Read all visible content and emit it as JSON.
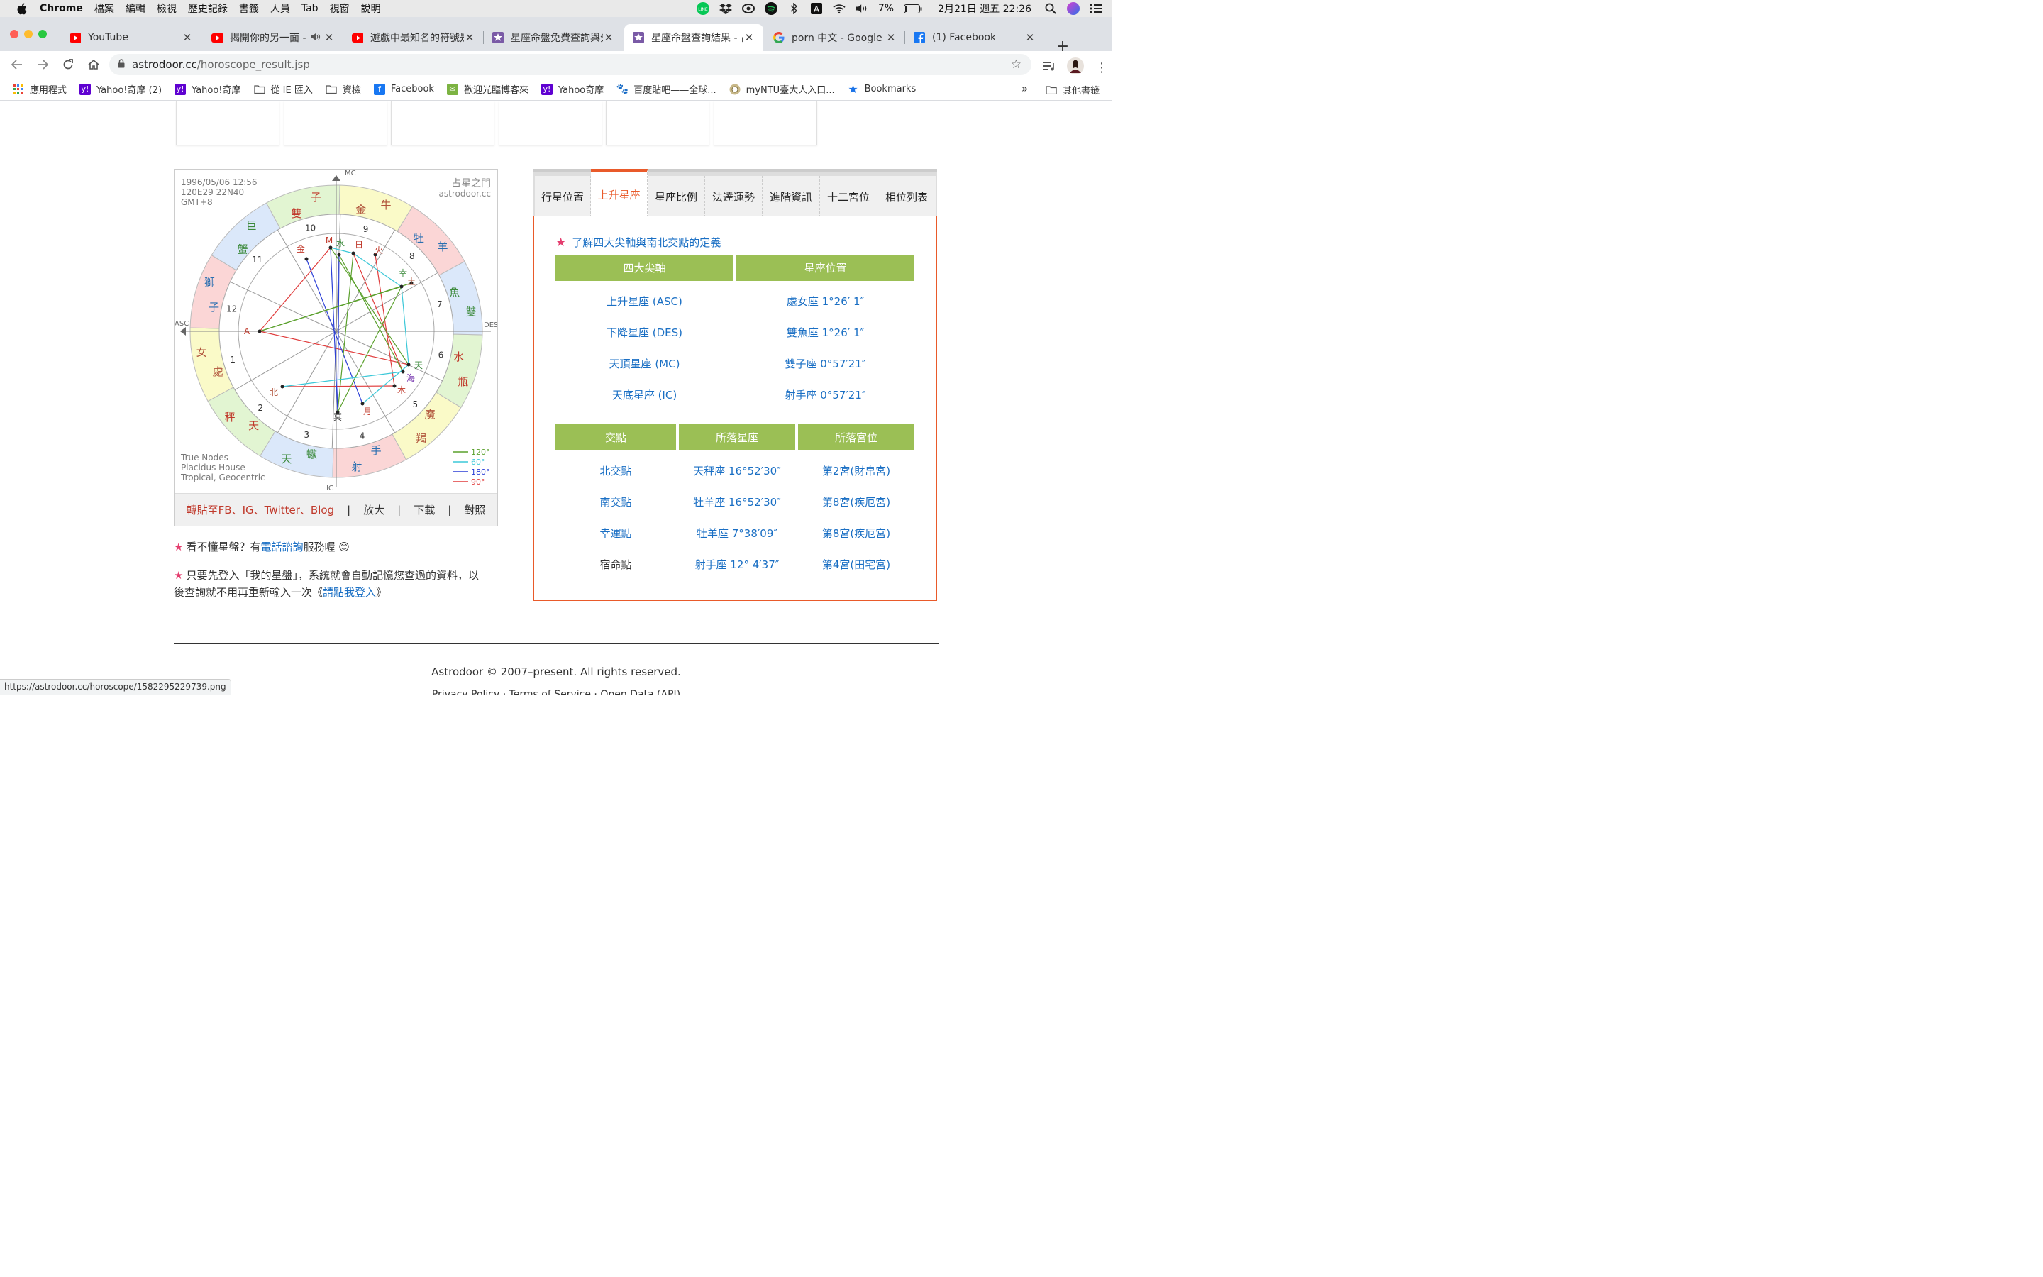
{
  "menubar": {
    "app": "Chrome",
    "items": [
      "檔案",
      "編輯",
      "檢視",
      "歷史記錄",
      "書籤",
      "人員",
      "Tab",
      "視窗",
      "說明"
    ],
    "battery": "7%",
    "datetime": "2月21日 週五  22:26"
  },
  "tabs": [
    {
      "title": "YouTube",
      "icon": "youtube-icon",
      "active": false
    },
    {
      "title": "揭開你的另一面 -",
      "icon": "youtube-icon",
      "active": false,
      "audio": true
    },
    {
      "title": "遊戲中最知名的符號是",
      "icon": "youtube-icon",
      "active": false
    },
    {
      "title": "星座命盤免費查詢與分",
      "icon": "astrodoor-icon",
      "active": false
    },
    {
      "title": "星座命盤查詢結果 - 占",
      "icon": "astrodoor-icon",
      "active": true
    },
    {
      "title": "porn 中文 - Google 搜",
      "icon": "google-icon",
      "active": false
    },
    {
      "title": "(1) Facebook",
      "icon": "facebook-icon",
      "active": false
    }
  ],
  "address": {
    "host": "astrodoor.cc",
    "path": "/horoscope_result.jsp"
  },
  "bookmarks": [
    "應用程式",
    "Yahoo!奇摩 (2)",
    "Yahoo!奇摩",
    "從 IE 匯入",
    "資檢",
    "Facebook",
    "歡迎光臨博客來",
    "Yahoo奇摩",
    "百度貼吧——全球...",
    "myNTU臺大人入口...",
    "Bookmarks"
  ],
  "bookmarks_more": "»",
  "bookmarks_other": "其他書籤",
  "chart": {
    "info": [
      "1996/05/06 12:56",
      "120E29 22N40",
      "GMT+8"
    ],
    "brand": [
      "占星之門",
      "astrodoor.cc"
    ],
    "footer": [
      "True Nodes",
      "Placidus House",
      "Tropical, Geocentric"
    ],
    "legend": [
      {
        "label": "120°",
        "color": "#5aa02c"
      },
      {
        "label": "60°",
        "color": "#3cc8d8"
      },
      {
        "label": "180°",
        "color": "#2b3fd6"
      },
      {
        "label": "90°",
        "color": "#e03c3c"
      }
    ],
    "axes": {
      "mc": "MC",
      "ic": "IC",
      "asc": "ASC",
      "des": "DES"
    },
    "signs": [
      "子",
      "雙",
      "牛",
      "金",
      "羊",
      "牡",
      "魚",
      "雙",
      "瓶",
      "水",
      "羯",
      "魔",
      "手",
      "射",
      "蠍",
      "天",
      "秤",
      "天",
      "女",
      "處",
      "子",
      "獅",
      "蟹",
      "巨"
    ],
    "houses": [
      "1",
      "2",
      "3",
      "4",
      "5",
      "6",
      "7",
      "8",
      "9",
      "10",
      "11",
      "12"
    ],
    "planets": [
      "M",
      "水",
      "日",
      "火",
      "金",
      "幸",
      "土",
      "A",
      "天",
      "海",
      "木",
      "北",
      "冥",
      "月"
    ]
  },
  "chart_links": {
    "share": "轉貼至FB、IG、Twitter、Blog",
    "zoom": "放大",
    "download": "下載",
    "compare": "對照",
    "sep": "|"
  },
  "notes": {
    "n1_pre": "看不懂星盤？有",
    "n1_link": "電話諮詢",
    "n1_post": "服務喔 😊",
    "n2_line1": "只要先登入「我的星盤」，系統就會自動記憶您查過的資料，以",
    "n2_line2_pre": "後查詢就不用再重新輸入一次《",
    "n2_link": "請點我登入",
    "n2_line2_post": "》",
    "star": "★"
  },
  "panel_tabs": [
    "行星位置",
    "上升星座",
    "星座比例",
    "法達運勢",
    "進階資訊",
    "十二宮位",
    "相位列表"
  ],
  "panel": {
    "link_star": "★",
    "link": "了解四大尖軸與南北交點的定義",
    "axes_headers": [
      "四大尖軸",
      "星座位置"
    ],
    "axes_rows": [
      [
        "上升星座 (ASC)",
        "處女座 1°26′ 1″"
      ],
      [
        "下降星座 (DES)",
        "雙魚座 1°26′ 1″"
      ],
      [
        "天頂星座 (MC)",
        "雙子座 0°57′21″"
      ],
      [
        "天底星座 (IC)",
        "射手座 0°57′21″"
      ]
    ],
    "nodes_headers": [
      "交點",
      "所落星座",
      "所落宮位"
    ],
    "nodes_rows": [
      [
        "北交點",
        "天秤座 16°52′30″",
        "第2宮(財帛宮)"
      ],
      [
        "南交點",
        "牡羊座 16°52′30″",
        "第8宮(疾厄宮)"
      ],
      [
        "幸運點",
        "牡羊座 7°38′09″",
        "第8宮(疾厄宮)"
      ],
      [
        "宿命點",
        "射手座 12° 4′37″",
        "第4宮(田宅宮)"
      ]
    ]
  },
  "footer": {
    "copyright": "Astrodoor © 2007–present. All rights reserved.",
    "links": "Privacy Policy · Terms of Service · Open Data (API)"
  },
  "status_url": "https://astrodoor.cc/horoscope/1582295229739.png"
}
